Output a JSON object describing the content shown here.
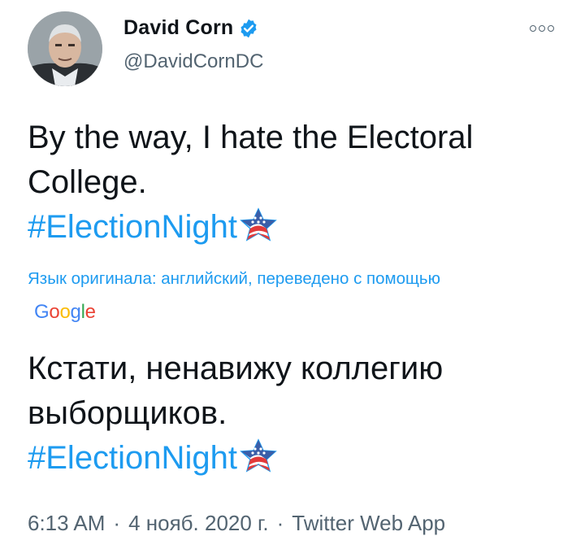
{
  "author": {
    "display_name": "David Corn",
    "handle": "@DavidCornDC",
    "verified": true
  },
  "tweet": {
    "original_lines": [
      "By the way, I hate the Electoral",
      "College."
    ],
    "hashtag": "#ElectionNight",
    "translation_notice": "Язык оригинала: английский, переведено с помощью",
    "translator_logo": [
      "G",
      "o",
      "o",
      "g",
      "l",
      "e"
    ],
    "translated_lines": [
      "Кстати, ненавижу коллегию",
      "выборщиков."
    ],
    "translated_hashtag": "#ElectionNight"
  },
  "meta": {
    "time": "6:13 AM",
    "date": "4 нояб. 2020 г.",
    "source": "Twitter Web App",
    "separator": "·"
  },
  "icons": {
    "more": "more-options-icon",
    "verified": "verified-badge-icon",
    "emoji": "star-flag-emoji-icon"
  },
  "colors": {
    "link": "#1d9bf0",
    "text": "#0f1419",
    "secondary": "#536471",
    "google_blue": "#4285f4",
    "google_red": "#ea4335",
    "google_yellow": "#fbbc05",
    "google_green": "#34a853"
  }
}
